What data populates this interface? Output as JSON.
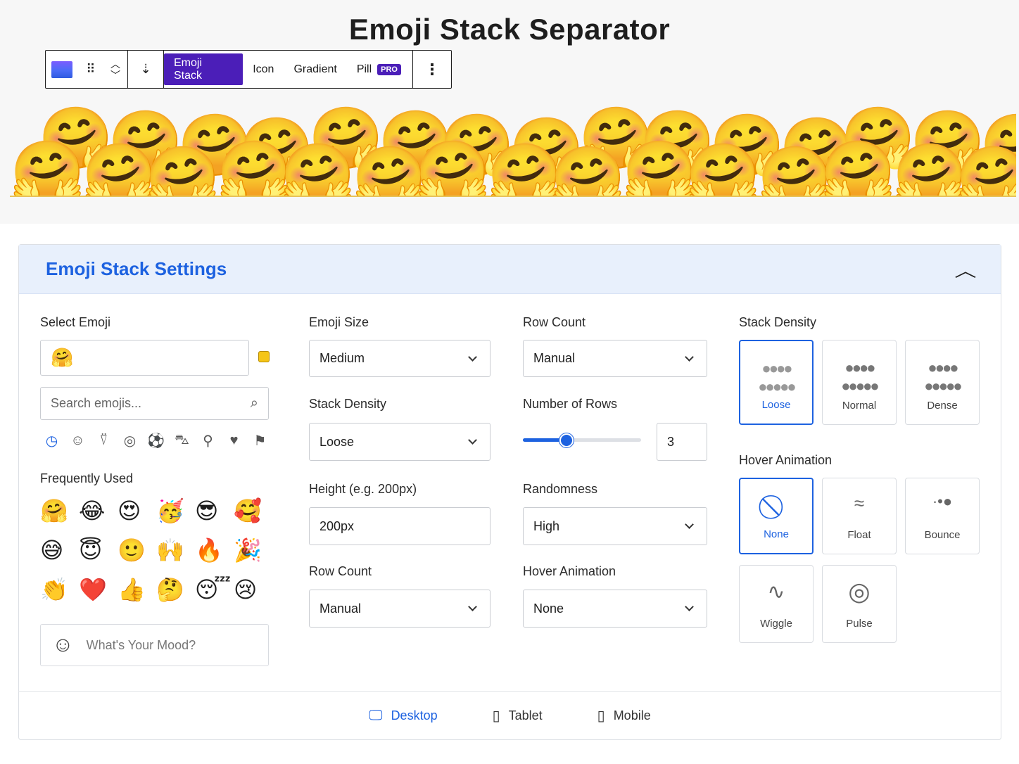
{
  "page": {
    "title": "Emoji Stack Separator"
  },
  "toolbar": {
    "tabs": [
      "Emoji Stack",
      "Icon",
      "Gradient",
      "Pill"
    ],
    "pro_badge": "PRO",
    "active_tab": "Emoji Stack",
    "icons": [
      "block-icon",
      "drag-handle-icon",
      "move-up-icon",
      "move-down-icon",
      "align-icon",
      "more-options-icon"
    ]
  },
  "preview": {
    "emoji": "🤗"
  },
  "settings": {
    "title": "Emoji Stack Settings",
    "select_emoji": {
      "label": "Select Emoji",
      "value": "🤗",
      "search_placeholder": "Search emojis...",
      "category_icons": [
        "recent-icon",
        "smileys-icon",
        "animals-icon",
        "food-icon",
        "activity-icon",
        "travel-icon",
        "objects-icon",
        "symbols-icon",
        "flags-icon"
      ],
      "frequently_used_label": "Frequently Used",
      "frequently_used": [
        "🤗",
        "😂",
        "😍",
        "🥳",
        "😎",
        "🥰",
        "😅",
        "😇",
        "🙂",
        "🙌",
        "🔥",
        "🎉",
        "👏",
        "❤️",
        "👍",
        "🤔",
        "😴",
        "😢"
      ],
      "mood_placeholder": "What's Your Mood?"
    },
    "emoji_size": {
      "label": "Emoji Size",
      "value": "Medium"
    },
    "stack_density_select": {
      "label": "Stack Density",
      "value": "Loose"
    },
    "height": {
      "label": "Height (e.g. 200px)",
      "value": "200px"
    },
    "row_count_left": {
      "label": "Row Count",
      "value": "Manual"
    },
    "row_count_right": {
      "label": "Row Count",
      "value": "Manual"
    },
    "number_of_rows": {
      "label": "Number of Rows",
      "value": "3",
      "slider_fraction": 0.37
    },
    "randomness": {
      "label": "Randomness",
      "value": "High"
    },
    "hover_animation_select": {
      "label": "Hover Animation",
      "value": "None"
    },
    "stack_density_options": {
      "label": "Stack Density",
      "options": [
        "Loose",
        "Normal",
        "Dense"
      ],
      "selected": "Loose"
    },
    "hover_animation_options": {
      "label": "Hover Animation",
      "options": [
        "None",
        "Float",
        "Bounce",
        "Wiggle",
        "Pulse"
      ],
      "selected": "None"
    }
  },
  "devices": {
    "items": [
      "Desktop",
      "Tablet",
      "Mobile"
    ],
    "active": "Desktop"
  },
  "colors": {
    "accent": "#1d62e0",
    "toolbar_active": "#4b1eb8",
    "panel_header": "#e8f0fc"
  }
}
